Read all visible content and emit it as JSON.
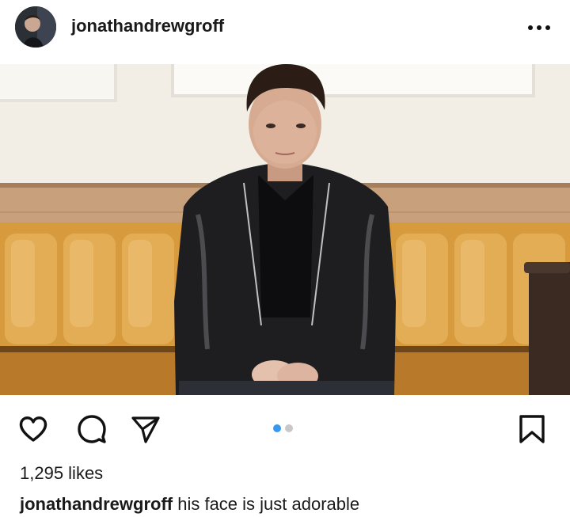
{
  "post": {
    "username": "jonathandrewgroff",
    "likes": "1,295 likes",
    "caption_user": "jonathandrewgroff",
    "caption_text": " his face is just adorable",
    "carousel": {
      "total": 2,
      "active": 1
    },
    "icons": {
      "more": "more-options-icon",
      "like": "heart-icon",
      "comment": "comment-bubble-icon",
      "share": "paper-plane-icon",
      "save": "bookmark-icon"
    },
    "colors": {
      "accent": "#3897f0",
      "inactive_dot": "#c8c8c8",
      "text": "#1a1a1a"
    }
  }
}
